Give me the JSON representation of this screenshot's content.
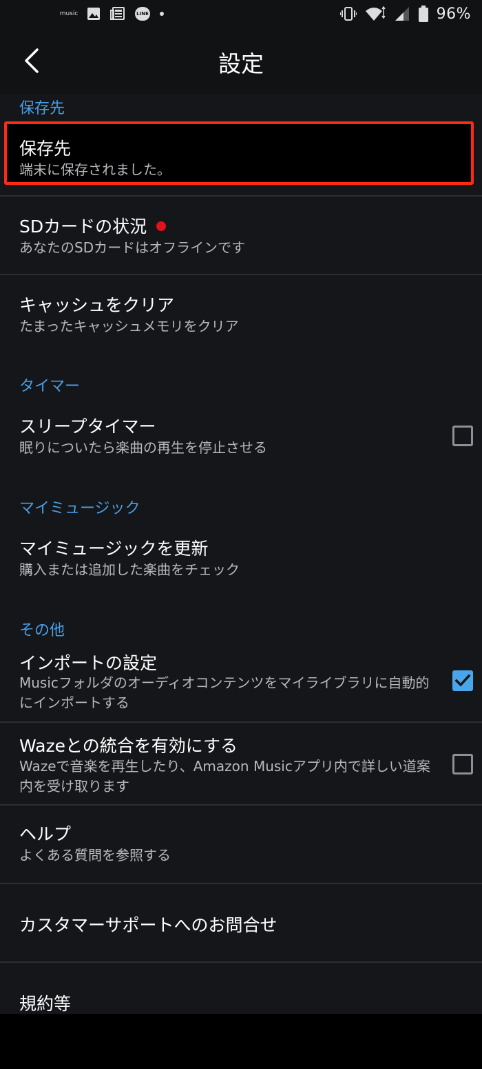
{
  "status_bar": {
    "music_label": "music",
    "line_label": "LINE",
    "battery_percent": "96%"
  },
  "header": {
    "title": "設定"
  },
  "sections": {
    "storage": {
      "header": "保存先",
      "storage_location": {
        "title": "保存先",
        "subtitle": "端末に保存されました。"
      },
      "sd_card": {
        "title": "SDカードの状況",
        "subtitle": "あなたのSDカードはオフラインです"
      },
      "clear_cache": {
        "title": "キャッシュをクリア",
        "subtitle": "たまったキャッシュメモリをクリア"
      }
    },
    "timer": {
      "header": "タイマー",
      "sleep_timer": {
        "title": "スリープタイマー",
        "subtitle": "眠りについたら楽曲の再生を停止させる",
        "checked": false
      }
    },
    "my_music": {
      "header": "マイミュージック",
      "refresh": {
        "title": "マイミュージックを更新",
        "subtitle": "購入または追加した楽曲をチェック"
      }
    },
    "other": {
      "header": "その他",
      "import_settings": {
        "title": "インポートの設定",
        "subtitle": "Musicフォルダのオーディオコンテンツをマイライブラリに自動的にインポートする",
        "checked": true
      },
      "waze": {
        "title": "Wazeとの統合を有効にする",
        "subtitle": "Wazeで音楽を再生したり、Amazon Musicアプリ内で詳しい道案内を受け取ります",
        "checked": false
      },
      "help": {
        "title": "ヘルプ",
        "subtitle": "よくある質問を参照する"
      },
      "customer_support": {
        "title": "カスタマーサポートへのお問合せ"
      },
      "terms": {
        "title": "規約等"
      }
    }
  },
  "colors": {
    "section_header": "#4a9fe8",
    "highlight_border": "#ff2a14",
    "checkbox_checked": "#4aa6ea",
    "sd_status_dot": "#e2111b"
  }
}
